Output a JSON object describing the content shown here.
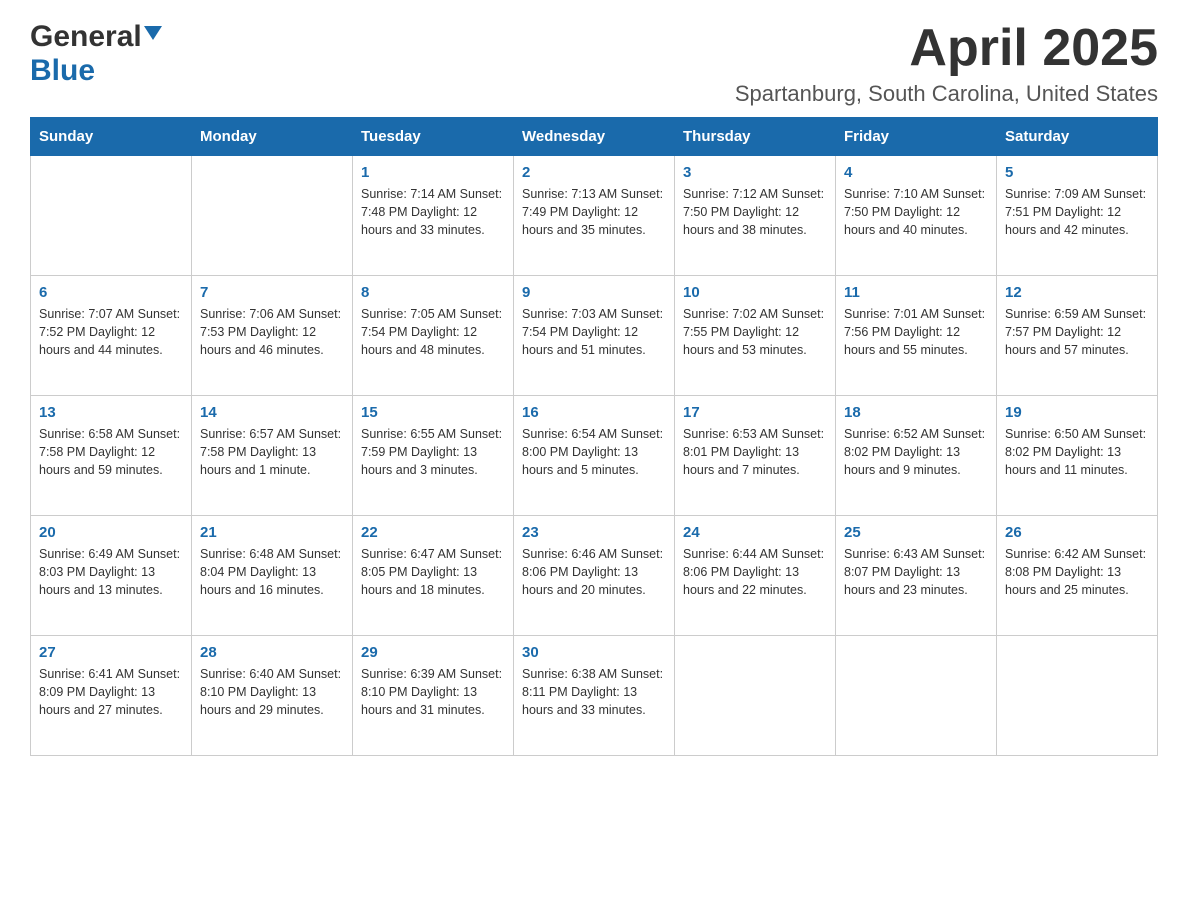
{
  "header": {
    "logo_general": "General",
    "logo_blue": "Blue",
    "month_title": "April 2025",
    "location": "Spartanburg, South Carolina, United States"
  },
  "weekdays": [
    "Sunday",
    "Monday",
    "Tuesday",
    "Wednesday",
    "Thursday",
    "Friday",
    "Saturday"
  ],
  "weeks": [
    [
      {
        "day": "",
        "info": ""
      },
      {
        "day": "",
        "info": ""
      },
      {
        "day": "1",
        "info": "Sunrise: 7:14 AM\nSunset: 7:48 PM\nDaylight: 12 hours\nand 33 minutes."
      },
      {
        "day": "2",
        "info": "Sunrise: 7:13 AM\nSunset: 7:49 PM\nDaylight: 12 hours\nand 35 minutes."
      },
      {
        "day": "3",
        "info": "Sunrise: 7:12 AM\nSunset: 7:50 PM\nDaylight: 12 hours\nand 38 minutes."
      },
      {
        "day": "4",
        "info": "Sunrise: 7:10 AM\nSunset: 7:50 PM\nDaylight: 12 hours\nand 40 minutes."
      },
      {
        "day": "5",
        "info": "Sunrise: 7:09 AM\nSunset: 7:51 PM\nDaylight: 12 hours\nand 42 minutes."
      }
    ],
    [
      {
        "day": "6",
        "info": "Sunrise: 7:07 AM\nSunset: 7:52 PM\nDaylight: 12 hours\nand 44 minutes."
      },
      {
        "day": "7",
        "info": "Sunrise: 7:06 AM\nSunset: 7:53 PM\nDaylight: 12 hours\nand 46 minutes."
      },
      {
        "day": "8",
        "info": "Sunrise: 7:05 AM\nSunset: 7:54 PM\nDaylight: 12 hours\nand 48 minutes."
      },
      {
        "day": "9",
        "info": "Sunrise: 7:03 AM\nSunset: 7:54 PM\nDaylight: 12 hours\nand 51 minutes."
      },
      {
        "day": "10",
        "info": "Sunrise: 7:02 AM\nSunset: 7:55 PM\nDaylight: 12 hours\nand 53 minutes."
      },
      {
        "day": "11",
        "info": "Sunrise: 7:01 AM\nSunset: 7:56 PM\nDaylight: 12 hours\nand 55 minutes."
      },
      {
        "day": "12",
        "info": "Sunrise: 6:59 AM\nSunset: 7:57 PM\nDaylight: 12 hours\nand 57 minutes."
      }
    ],
    [
      {
        "day": "13",
        "info": "Sunrise: 6:58 AM\nSunset: 7:58 PM\nDaylight: 12 hours\nand 59 minutes."
      },
      {
        "day": "14",
        "info": "Sunrise: 6:57 AM\nSunset: 7:58 PM\nDaylight: 13 hours\nand 1 minute."
      },
      {
        "day": "15",
        "info": "Sunrise: 6:55 AM\nSunset: 7:59 PM\nDaylight: 13 hours\nand 3 minutes."
      },
      {
        "day": "16",
        "info": "Sunrise: 6:54 AM\nSunset: 8:00 PM\nDaylight: 13 hours\nand 5 minutes."
      },
      {
        "day": "17",
        "info": "Sunrise: 6:53 AM\nSunset: 8:01 PM\nDaylight: 13 hours\nand 7 minutes."
      },
      {
        "day": "18",
        "info": "Sunrise: 6:52 AM\nSunset: 8:02 PM\nDaylight: 13 hours\nand 9 minutes."
      },
      {
        "day": "19",
        "info": "Sunrise: 6:50 AM\nSunset: 8:02 PM\nDaylight: 13 hours\nand 11 minutes."
      }
    ],
    [
      {
        "day": "20",
        "info": "Sunrise: 6:49 AM\nSunset: 8:03 PM\nDaylight: 13 hours\nand 13 minutes."
      },
      {
        "day": "21",
        "info": "Sunrise: 6:48 AM\nSunset: 8:04 PM\nDaylight: 13 hours\nand 16 minutes."
      },
      {
        "day": "22",
        "info": "Sunrise: 6:47 AM\nSunset: 8:05 PM\nDaylight: 13 hours\nand 18 minutes."
      },
      {
        "day": "23",
        "info": "Sunrise: 6:46 AM\nSunset: 8:06 PM\nDaylight: 13 hours\nand 20 minutes."
      },
      {
        "day": "24",
        "info": "Sunrise: 6:44 AM\nSunset: 8:06 PM\nDaylight: 13 hours\nand 22 minutes."
      },
      {
        "day": "25",
        "info": "Sunrise: 6:43 AM\nSunset: 8:07 PM\nDaylight: 13 hours\nand 23 minutes."
      },
      {
        "day": "26",
        "info": "Sunrise: 6:42 AM\nSunset: 8:08 PM\nDaylight: 13 hours\nand 25 minutes."
      }
    ],
    [
      {
        "day": "27",
        "info": "Sunrise: 6:41 AM\nSunset: 8:09 PM\nDaylight: 13 hours\nand 27 minutes."
      },
      {
        "day": "28",
        "info": "Sunrise: 6:40 AM\nSunset: 8:10 PM\nDaylight: 13 hours\nand 29 minutes."
      },
      {
        "day": "29",
        "info": "Sunrise: 6:39 AM\nSunset: 8:10 PM\nDaylight: 13 hours\nand 31 minutes."
      },
      {
        "day": "30",
        "info": "Sunrise: 6:38 AM\nSunset: 8:11 PM\nDaylight: 13 hours\nand 33 minutes."
      },
      {
        "day": "",
        "info": ""
      },
      {
        "day": "",
        "info": ""
      },
      {
        "day": "",
        "info": ""
      }
    ]
  ]
}
